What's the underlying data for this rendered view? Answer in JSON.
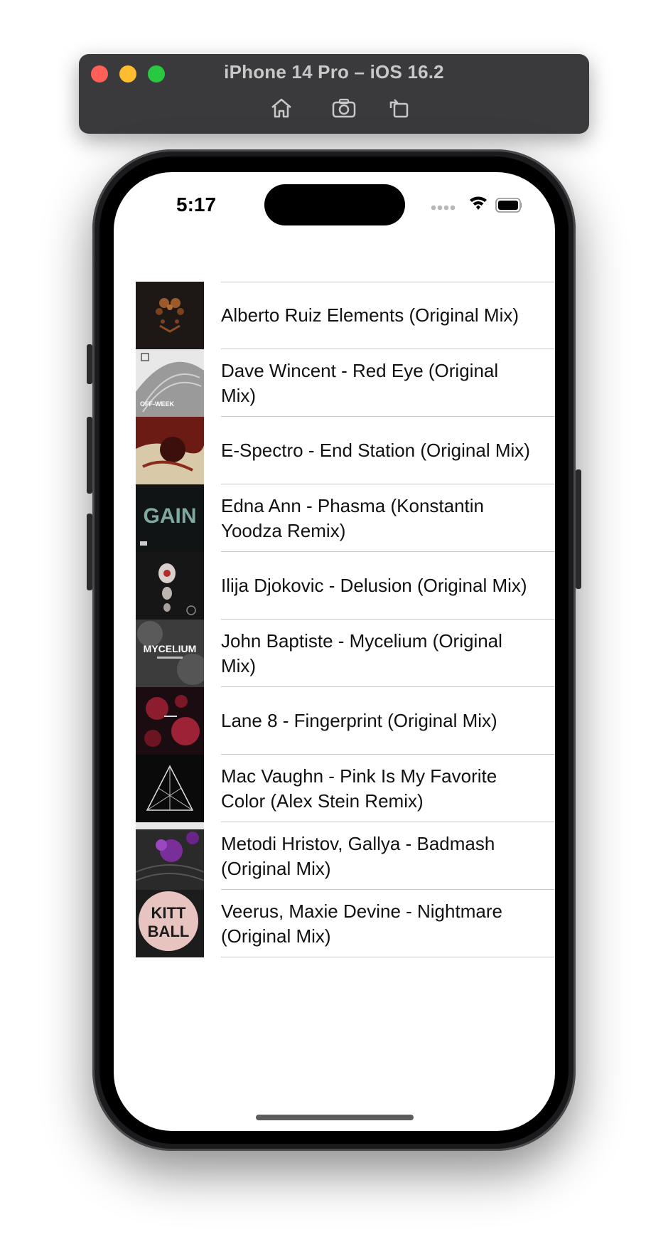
{
  "simulator": {
    "title": "iPhone 14 Pro – iOS 16.2",
    "buttons": [
      "home-icon",
      "screenshot-icon",
      "rotate-icon"
    ]
  },
  "status_bar": {
    "time": "5:17",
    "icons": [
      "signal-dots-icon",
      "wifi-icon",
      "battery-icon"
    ]
  },
  "tracks": [
    {
      "title": "Alberto Ruiz Elements (Original Mix)",
      "artwork": "dark brown rorschach artwork"
    },
    {
      "title": "Dave Wincent - Red Eye (Original Mix)",
      "artwork": "grey dome building artwork"
    },
    {
      "title": "E-Spectro - End Station (Original Mix)",
      "artwork": "red splash artwork"
    },
    {
      "title": "Edna Ann - Phasma (Konstantin Yoodza Remix)",
      "artwork": "GAIN logo artwork"
    },
    {
      "title": "Ilija Djokovic - Delusion (Original Mix)",
      "artwork": "eye collage artwork"
    },
    {
      "title": "John Baptiste - Mycelium (Original Mix)",
      "artwork": "MYCELIUM artwork"
    },
    {
      "title": "Lane 8 - Fingerprint (Original Mix)",
      "artwork": "red roses artwork"
    },
    {
      "title": "Mac Vaughn - Pink Is My Favorite Color (Alex Stein Remix)",
      "artwork": "triangle line artwork"
    },
    {
      "title": "Metodi Hristov, Gallya - Badmash (Original Mix)",
      "artwork": "purple flowers artwork"
    },
    {
      "title": "Veerus, Maxie Devine - Nightmare (Original Mix)",
      "artwork": "KITTBALL artwork"
    }
  ],
  "artwork_text": {
    "gain": "GAIN",
    "mycelium": "MYCELIUM",
    "kitt": "KITT",
    "ball": "BALL",
    "offweek": "OFF-WEEK"
  }
}
